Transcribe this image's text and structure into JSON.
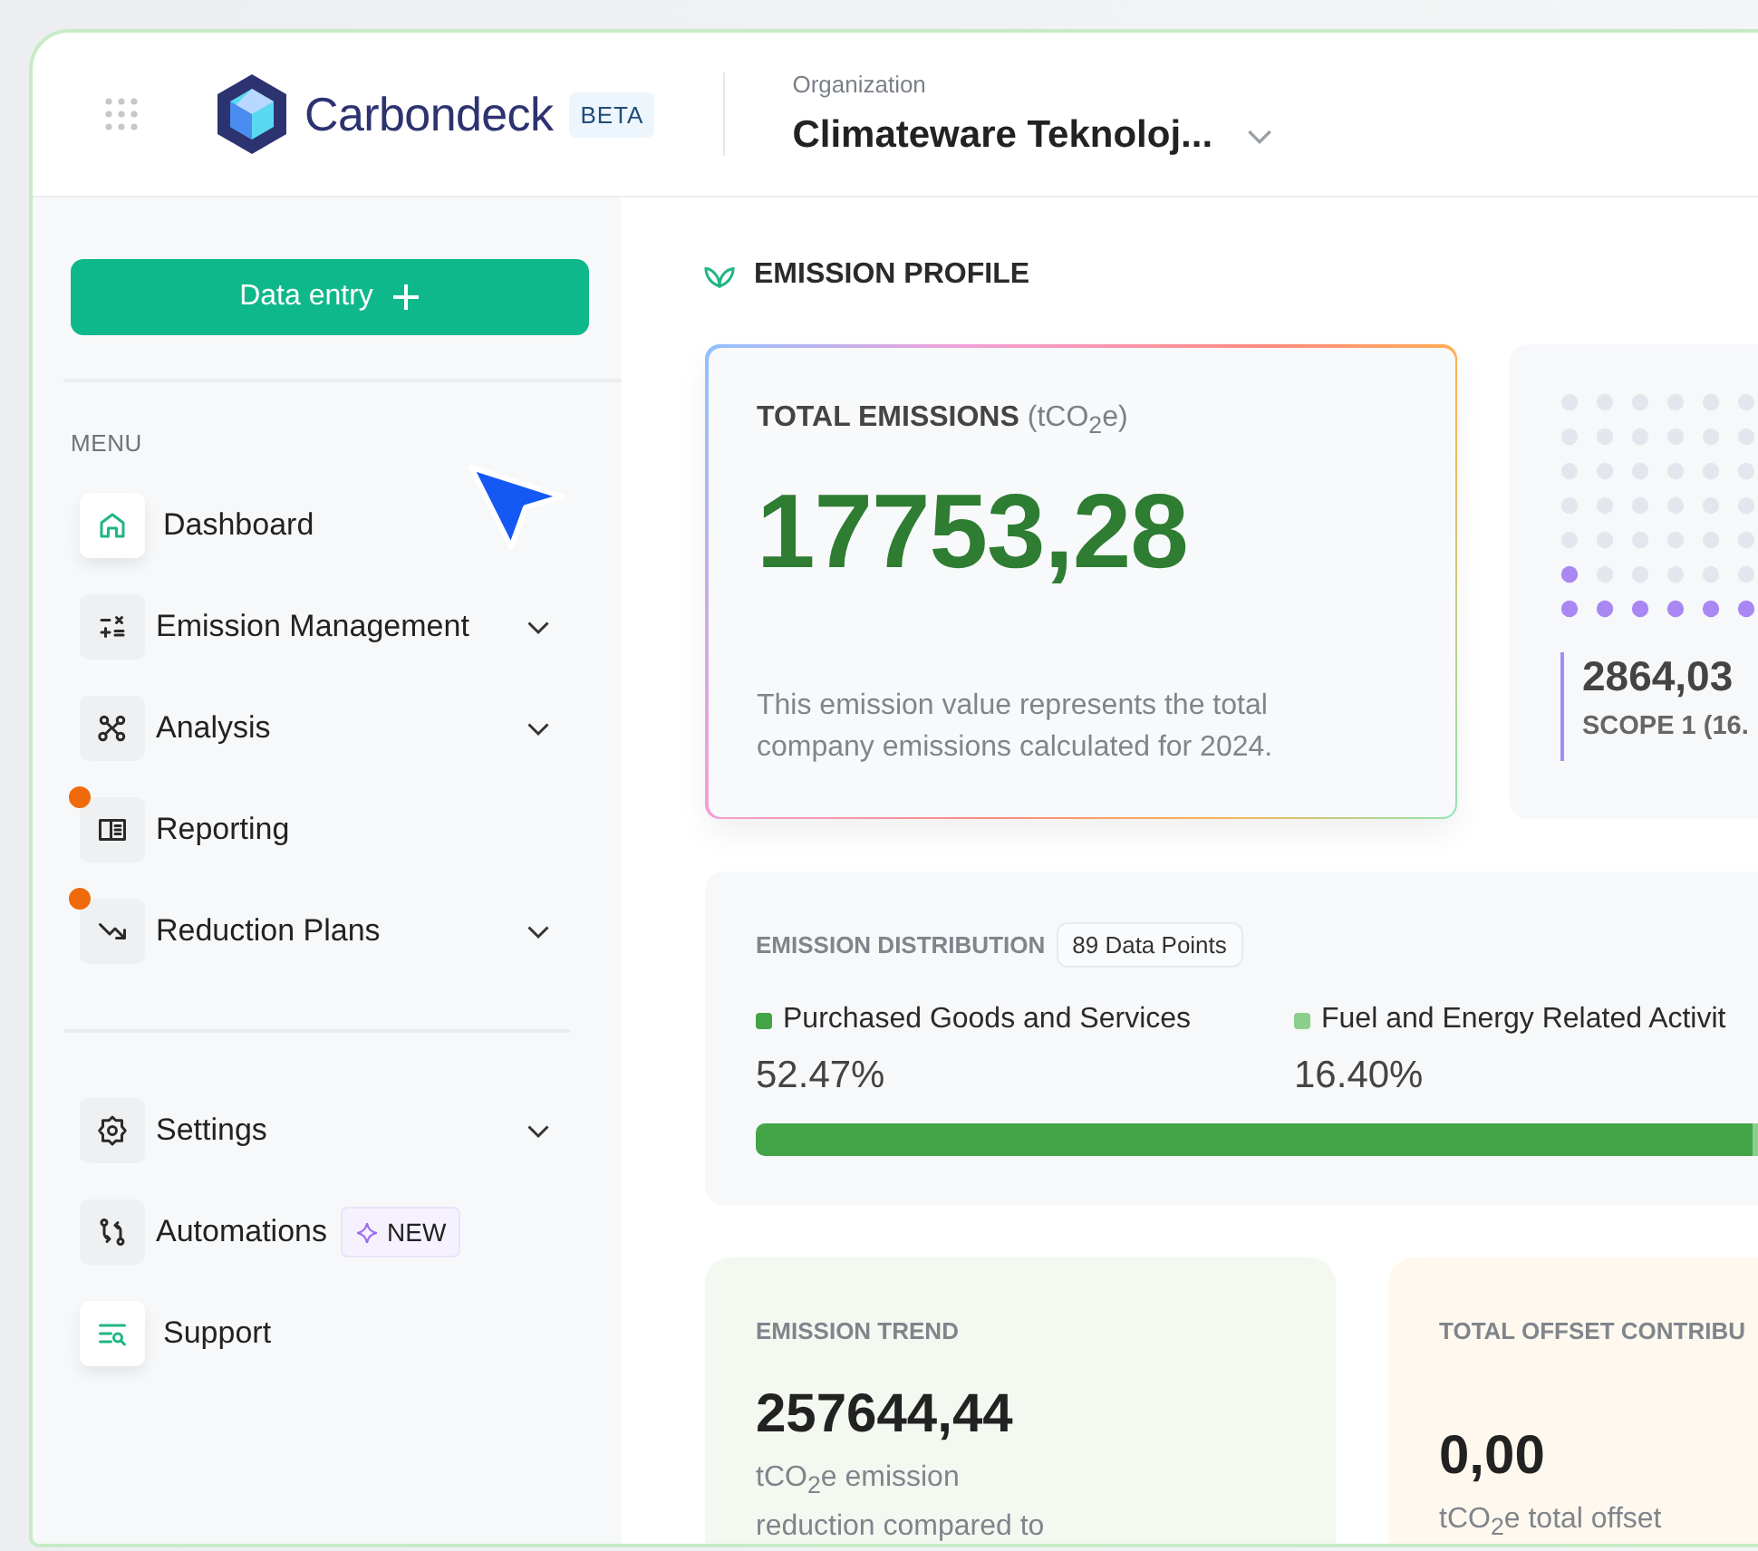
{
  "header": {
    "brand": "Carbondeck",
    "brand_badge": "BETA",
    "organization_label": "Organization",
    "organization_name": "Climateware Teknoloj..."
  },
  "sidebar": {
    "primary_action": "Data entry",
    "menu_label": "MENU",
    "items": [
      {
        "label": "Dashboard",
        "kind": "home",
        "selected": true,
        "expandable": false,
        "notification": false
      },
      {
        "label": "Emission Management",
        "kind": "calc",
        "selected": false,
        "expandable": true,
        "notification": false
      },
      {
        "label": "Analysis",
        "kind": "nodes",
        "selected": false,
        "expandable": true,
        "notification": false
      },
      {
        "label": "Reporting",
        "kind": "book",
        "selected": false,
        "expandable": false,
        "notification": true
      },
      {
        "label": "Reduction Plans",
        "kind": "trend",
        "selected": false,
        "expandable": true,
        "notification": true
      }
    ],
    "bottom_items": [
      {
        "label": "Settings",
        "kind": "gear",
        "selected": false,
        "expandable": true
      },
      {
        "label": "Automations",
        "kind": "flow",
        "selected": false,
        "expandable": false,
        "tag": "NEW"
      },
      {
        "label": "Support",
        "kind": "support",
        "selected": true,
        "expandable": false
      }
    ]
  },
  "section_title": "EMISSION PROFILE",
  "total_card": {
    "title": "TOTAL EMISSIONS",
    "unit": "(tCO$_{2}$e)",
    "value": "17753,28",
    "description": "This emission value represents the total company emissions calculated for 2024."
  },
  "scope_card": {
    "value": "2864,03",
    "label": "SCOPE 1 (16."
  },
  "distribution": {
    "title": "EMISSION DISTRIBUTION",
    "count": "89 Data Points",
    "categories": [
      {
        "name": "Purchased Goods and Services",
        "share": "52.47%",
        "color": "#43a447"
      },
      {
        "name": "Fuel and Energy Related Activit",
        "share": "16.40%",
        "color": "#8ccf8c"
      }
    ]
  },
  "trend_card": {
    "title": "EMISSION TREND",
    "value": "257644,44",
    "description": "tCO$_{2}$e emission reduction compared to"
  },
  "offset_card": {
    "title": "TOTAL OFFSET CONTRIBU",
    "value": "0,00",
    "description": "tCO$_{2}$e total offset"
  }
}
